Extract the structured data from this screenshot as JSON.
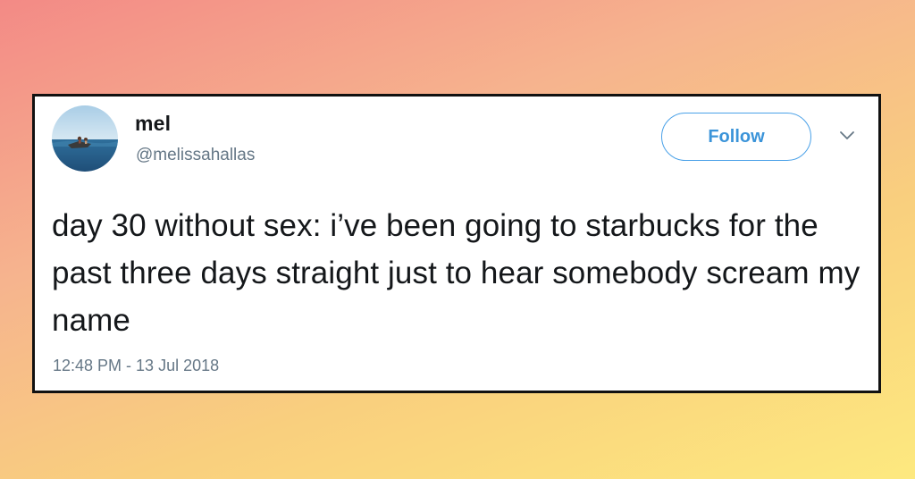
{
  "tweet": {
    "display_name": "mel",
    "handle": "@melissahallas",
    "follow_label": "Follow",
    "text": "day 30 without sex: i’ve been going to starbucks for the past three days straight just to hear somebody scream my name",
    "timestamp": "12:48 PM - 13 Jul 2018"
  },
  "icons": {
    "menu": "chevron-down-icon",
    "avatar": "avatar"
  },
  "colors": {
    "follow_blue": "#3b94d9",
    "secondary_text": "#657786",
    "primary_text": "#14171a",
    "card_border": "#111111",
    "background_gradient": [
      "#f38a86",
      "#f6b48e",
      "#f9cf7e",
      "#fde97f"
    ]
  }
}
